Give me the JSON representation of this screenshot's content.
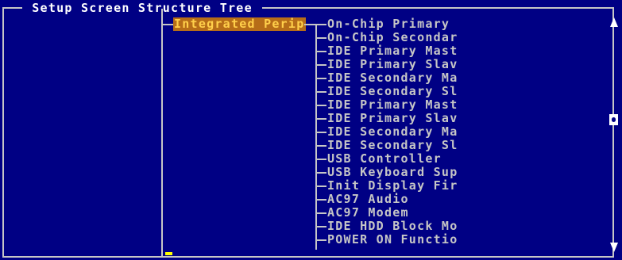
{
  "frame": {
    "title": " Setup Screen Structure Tree "
  },
  "tree": {
    "selected_node": "Integrated Perip",
    "children": [
      "On-Chip Primary",
      "On-Chip Secondar",
      "IDE Primary Mast",
      "IDE Primary Slav",
      "IDE Secondary Ma",
      "IDE Secondary Sl",
      "IDE Primary Mast",
      "IDE Primary Slav",
      "IDE Secondary Ma",
      "IDE Secondary Sl",
      "USB Controller",
      "USB Keyboard Sup",
      "Init Display Fir",
      "AC97 Audio",
      "AC97 Modem",
      "IDE HDD Block Mo",
      "POWER ON Functio"
    ]
  },
  "colors": {
    "background": "#000084",
    "text": "#c6c6c6",
    "title": "#ffffff",
    "highlight_bg": "#b66d18",
    "highlight_fg": "#ffcf4a",
    "cursor": "#ffff00"
  },
  "scrollbar": {
    "up_icon": "arrow-up-icon",
    "down_icon": "arrow-down-icon",
    "thumb_icon": "scroll-thumb-icon"
  }
}
